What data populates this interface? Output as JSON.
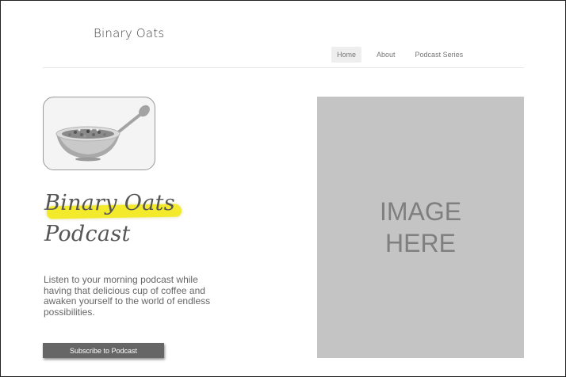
{
  "header": {
    "brand": "Binary Oats",
    "nav": [
      {
        "label": "Home"
      },
      {
        "label": "About"
      },
      {
        "label": "Podcast Series"
      }
    ]
  },
  "hero": {
    "title_line1": "Binary Oats",
    "title_line2": "Podcast",
    "description": "Listen to your morning podcast while having that delicious cup of coffee and awaken yourself to the world of endless possibilities.",
    "subscribe_label": "Subscribe to Podcast",
    "placeholder_line1": "IMAGE",
    "placeholder_line2": "HERE",
    "highlight_color": "#f2ea2a"
  }
}
